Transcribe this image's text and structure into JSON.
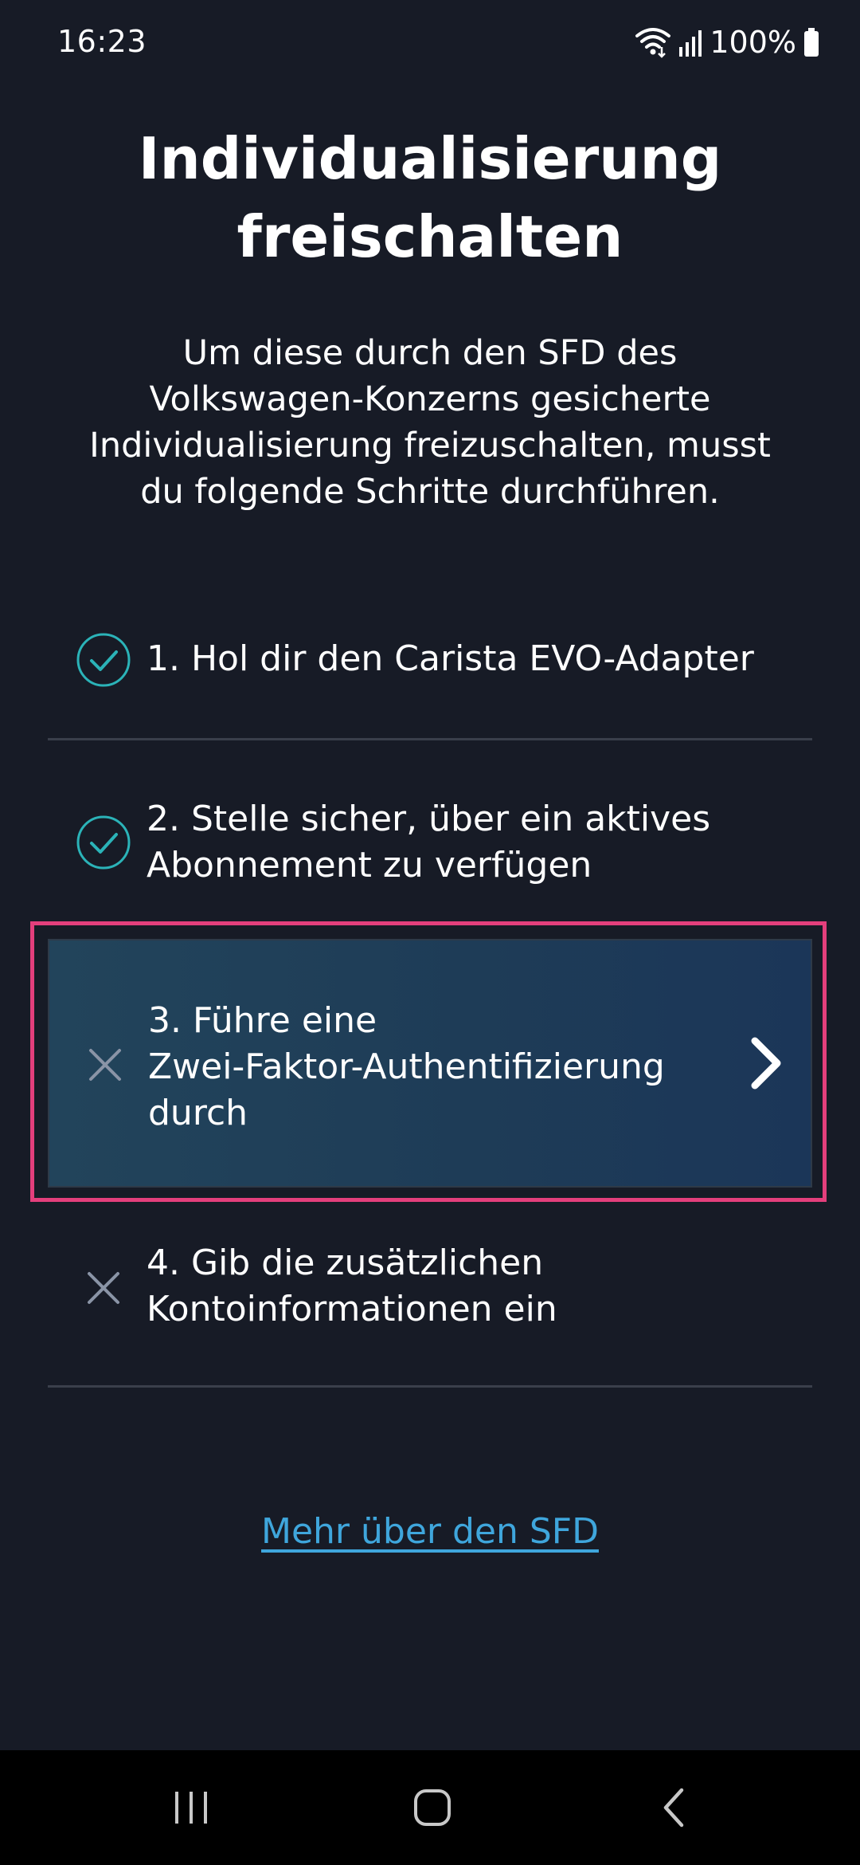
{
  "status_bar": {
    "time": "16:23",
    "battery": "100%",
    "icons": [
      "wifi-icon",
      "signal-icon",
      "battery-icon"
    ]
  },
  "header": {
    "title_line1": "Individualisierung",
    "title_line2": "freischalten",
    "subtitle_line1": "Um diese durch den SFD des",
    "subtitle_line2": "Volkswagen-Konzerns gesicherte",
    "subtitle_line3": "Individualisierung freizuschalten, musst",
    "subtitle_line4": "du folgende Schritte durchführen."
  },
  "steps": [
    {
      "line1": "1. Hol dir den Carista EVO-Adapter",
      "status": "done",
      "icon": "check-circle-icon"
    },
    {
      "line1": "2. Stelle sicher, über ein aktives",
      "line2": "Abonnement zu verfügen",
      "status": "done",
      "icon": "check-circle-icon"
    },
    {
      "line1": "3. Führe eine",
      "line2": "Zwei-Faktor-Authentifizierung",
      "line3": "durch",
      "status": "pending",
      "icon": "cross-icon",
      "highlighted": true
    },
    {
      "line1": "4. Gib die zusätzlichen",
      "line2": "Kontoinformationen ein",
      "status": "pending",
      "icon": "cross-icon"
    }
  ],
  "link": {
    "label": "Mehr über den SFD"
  },
  "colors": {
    "background": "#171b26",
    "check": "#2bb3b8",
    "link": "#3fa6dc",
    "highlight_border": "#e43f7c",
    "cross": "#8a94a6"
  }
}
